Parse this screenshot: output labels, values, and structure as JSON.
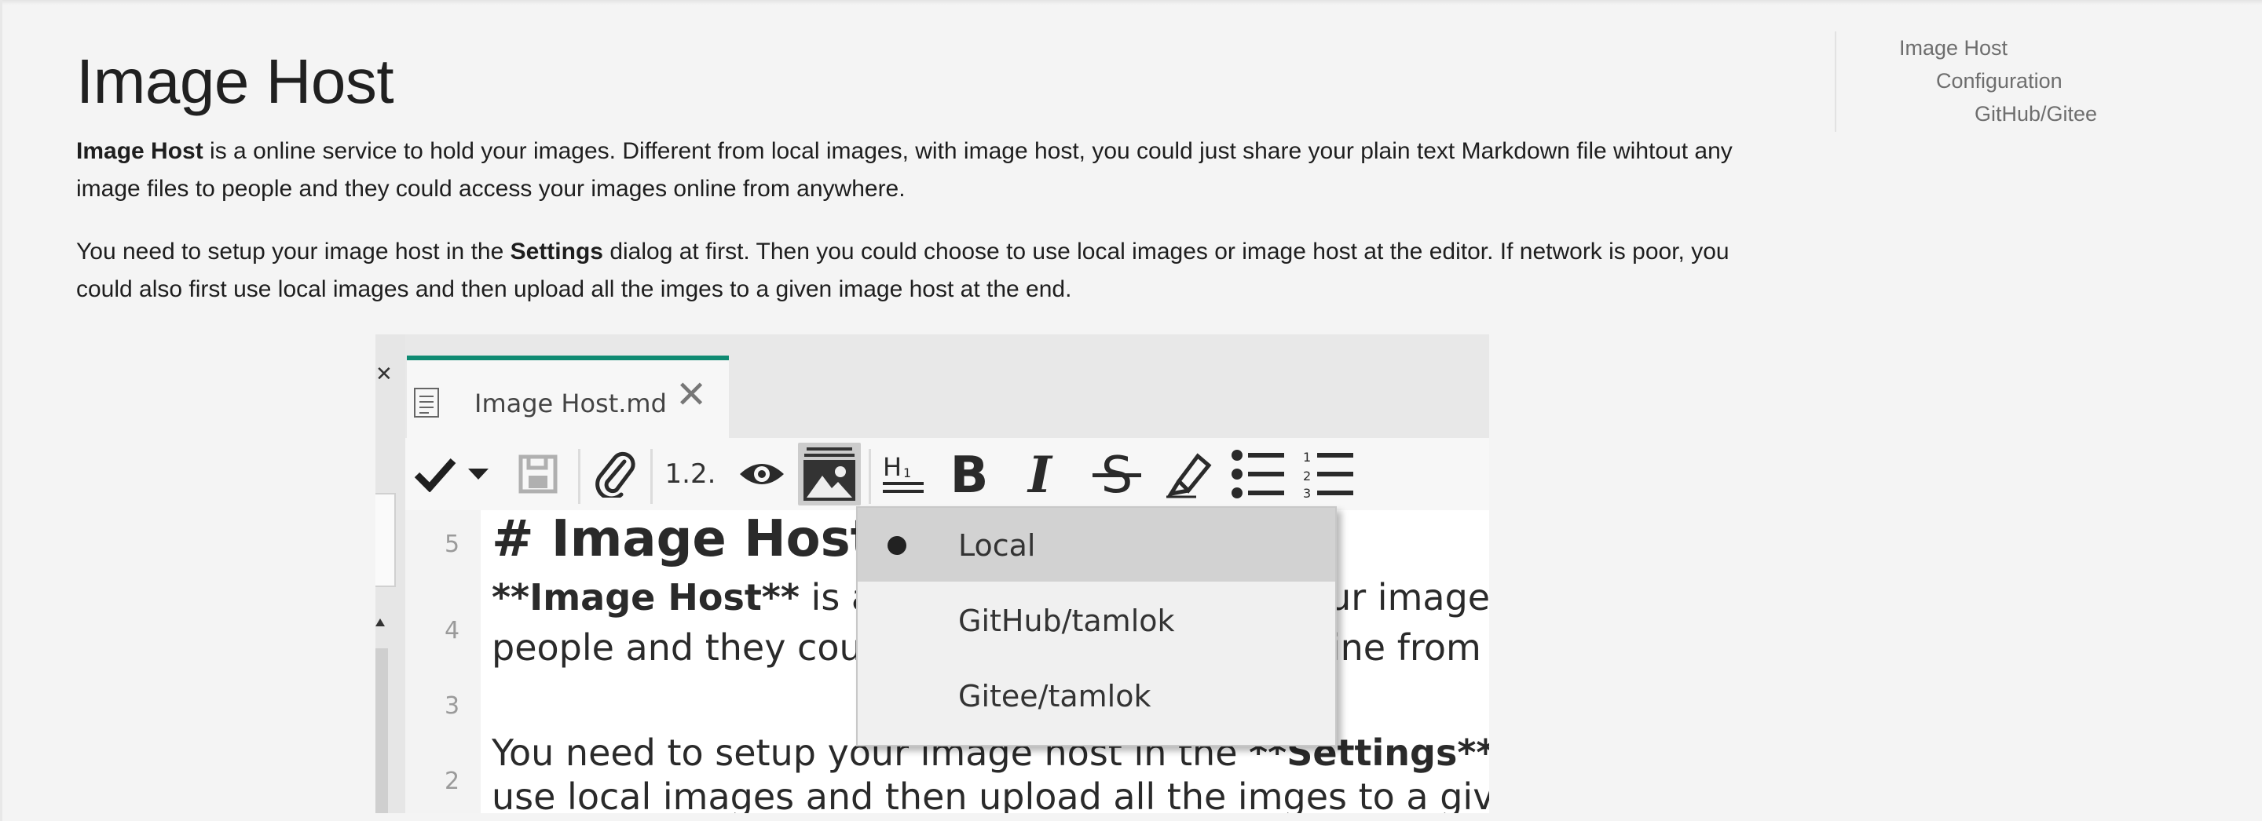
{
  "article": {
    "title": "Image Host",
    "p1": {
      "bold": "Image Host",
      "rest": " is a online service to hold your images. Different from local images, with image host, you could just share your plain text Markdown file wihtout any image files to people and they could access your images online from anywhere."
    },
    "p2": {
      "before": "You need to setup your image host in the ",
      "bold": "Settings",
      "after": " dialog at first. Then you could choose to use local images or image host at the editor. If network is poor, you could also first use local images and then upload all the imges to a given image host at the end."
    }
  },
  "toc": {
    "items": [
      "Image Host",
      "Configuration",
      "GitHub/Gitee"
    ]
  },
  "screenshot": {
    "tab": {
      "label": "Image Host.md",
      "close": "✕"
    },
    "left_close": "✕",
    "toolbar": {
      "numbered_label": "1.2.",
      "icons": [
        "check-icon",
        "chevron-down-icon",
        "save-icon",
        "attach-icon",
        "section-number-icon",
        "preview-icon",
        "image-host-icon",
        "heading-icon",
        "bold-icon",
        "italic-icon",
        "strikethrough-icon",
        "highlight-icon",
        "bullet-list-icon",
        "numbered-list-icon"
      ]
    },
    "gutter": [
      "5",
      "4",
      "3",
      "2"
    ],
    "editor": {
      "line1": "# Image Host",
      "line2_bold": "**Image Host**",
      "line2_rest": " is a online service to hold your images",
      "line3": "people and they could access your images online from",
      "line4_before": "You need to setup your image host in the ",
      "line4_bold": "**Settings**",
      "line5": "use local images and then upload all the imges to a given"
    },
    "menu": {
      "items": [
        {
          "label": "Local",
          "selected": true
        },
        {
          "label": "GitHub/tamlok",
          "selected": false
        },
        {
          "label": "Gitee/tamlok",
          "selected": false
        }
      ]
    }
  },
  "colors": {
    "tab_accent": "#0f8a72",
    "background": "#f4f4f4"
  }
}
